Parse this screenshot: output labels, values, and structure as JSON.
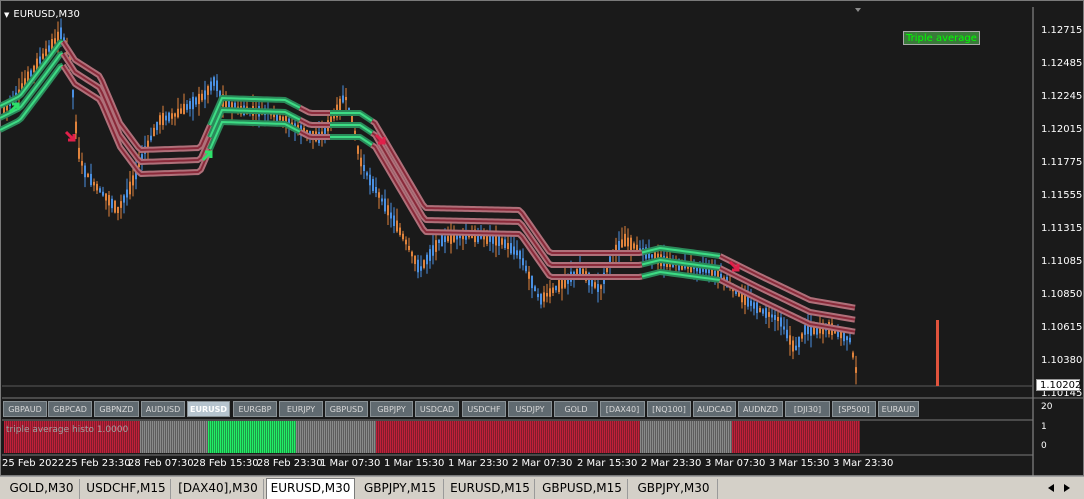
{
  "chart": {
    "title": "EURUSD,M30",
    "indicator_legend": "Triple average",
    "last_price": "1.10202",
    "price_labels": [
      "1.12715",
      "1.12485",
      "1.12245",
      "1.12015",
      "1.11775",
      "1.11555",
      "1.11315",
      "1.11085",
      "1.10850",
      "1.10615",
      "1.10380",
      "1.10145"
    ],
    "time_labels": [
      "25 Feb 2022",
      "25 Feb 23:30",
      "28 Feb 07:30",
      "28 Feb 15:30",
      "28 Feb 23:30",
      "1 Mar 07:30",
      "1 Mar 15:30",
      "1 Mar 23:30",
      "2 Mar 07:30",
      "2 Mar 15:30",
      "2 Mar 23:30",
      "3 Mar 07:30",
      "3 Mar 15:30",
      "3 Mar 23:30"
    ],
    "colors": {
      "background": "#1a1a1a",
      "bull_candle": "#4a90e2",
      "bear_candle": "#e0833c",
      "band_outer": "#b0707a",
      "band_inner_red": "#8a2a3a",
      "band_inner_green": "#3ddc84",
      "arrow_up": "#2ee06a",
      "arrow_down": "#e0204a"
    }
  },
  "symbols": [
    "GBPAUD",
    "GBPCAD",
    "GBPNZD",
    "AUDUSD",
    "EURUSD",
    "EURGBP",
    "EURJPY",
    "GBPUSD",
    "GBPJPY",
    "USDCAD",
    "USDCHF",
    "USDJPY",
    "GOLD",
    "[DAX40]",
    "[NQ100]",
    "AUDCAD",
    "AUDNZD",
    "[DJI30]",
    "[SP500]",
    "EURAUD"
  ],
  "symbol_active": "EURUSD",
  "indicator": {
    "label": "triple average histo 1.0000",
    "scale_top": "20",
    "scale_1": "1",
    "scale_0": "0",
    "colors": {
      "green": "#22ee66",
      "gray": "#8a8a8a",
      "red": "#c0203a"
    }
  },
  "scale_side_top": "20",
  "tabs": [
    "GOLD,M30",
    "USDCHF,M15",
    "[DAX40],M30",
    "EURUSD,M30",
    "GBPJPY,M15",
    "EURUSD,M15",
    "GBPUSD,M15",
    "GBPJPY,M30"
  ],
  "tab_active": "EURUSD,M30"
}
